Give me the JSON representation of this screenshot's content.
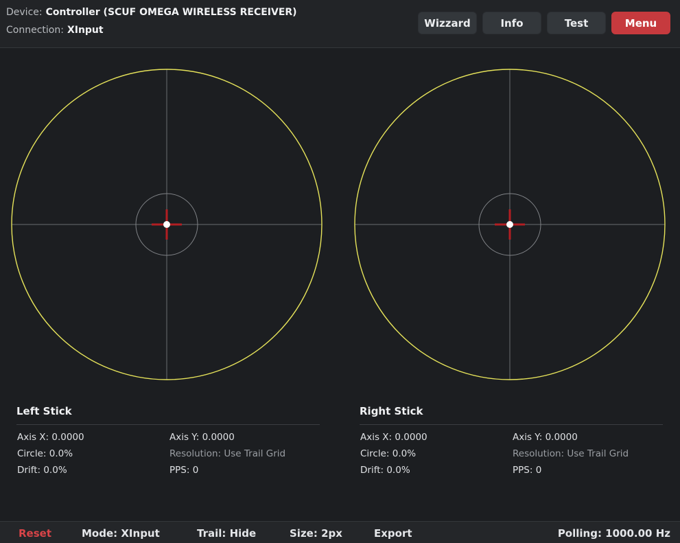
{
  "header": {
    "device_label": "Device:",
    "device_value": "Controller (SCUF OMEGA WIRELESS RECEIVER)",
    "connection_label": "Connection:",
    "connection_value": "XInput",
    "buttons": {
      "wizzard": "Wizzard",
      "info": "Info",
      "test": "Test",
      "menu": "Menu"
    }
  },
  "colors": {
    "outer_circle": "#e6e35a",
    "crosshair": "#6a6d71",
    "inner_circle": "#808387",
    "marker": "#b21e22",
    "dot": "#ffffff",
    "menu_button": "#c63a3e",
    "reset": "#d84448"
  },
  "left_stick": {
    "title": "Left Stick",
    "axis_x": "Axis X: 0.0000",
    "axis_y": "Axis Y: 0.0000",
    "circle": "Circle: 0.0%",
    "resolution": "Resolution: Use Trail Grid",
    "drift": "Drift: 0.0%",
    "pps": "PPS: 0",
    "x": 0.0,
    "y": 0.0
  },
  "right_stick": {
    "title": "Right Stick",
    "axis_x": "Axis X: 0.0000",
    "axis_y": "Axis Y: 0.0000",
    "circle": "Circle: 0.0%",
    "resolution": "Resolution: Use Trail Grid",
    "drift": "Drift: 0.0%",
    "pps": "PPS: 0",
    "x": 0.0,
    "y": 0.0
  },
  "footer": {
    "reset": "Reset",
    "mode": "Mode: XInput",
    "trail": "Trail: Hide",
    "size": "Size: 2px",
    "export": "Export",
    "polling": "Polling: 1000.00 Hz"
  }
}
